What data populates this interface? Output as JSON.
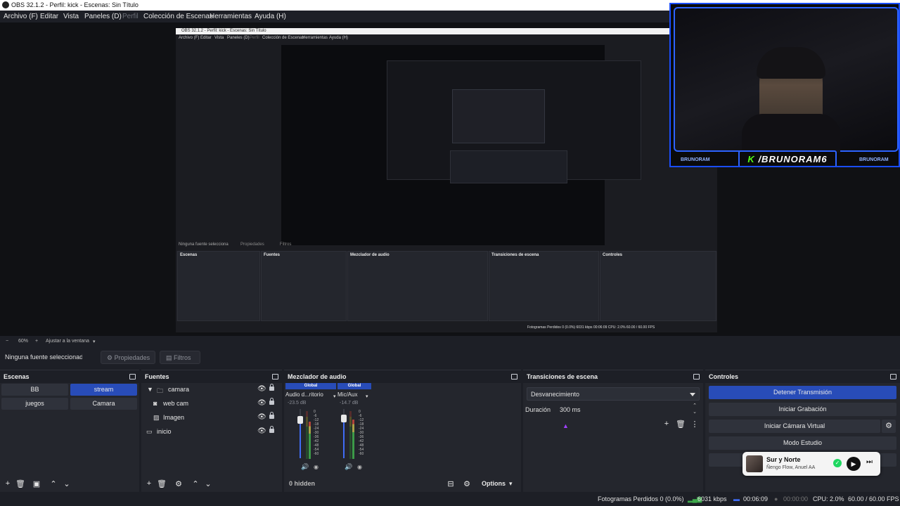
{
  "window": {
    "title": "OBS 32.1.2 - Perfil: kick - Escenas: Sin Título"
  },
  "menu": {
    "items": [
      "Archivo (F)",
      "Editar",
      "Vista",
      "Paneles (D)",
      "Perfil",
      "Colección de Escenas",
      "Herramientas",
      "Ayuda (H)"
    ]
  },
  "nested_preview": {
    "title": "OBS 32.1.2 - Perfil: kick - Escenas: Sin Título",
    "menu": [
      "Archivo (F)",
      "Editar",
      "Vista",
      "Paneles (D)",
      "Perfil",
      "Colección de Escenas",
      "Herramientas",
      "Ayuda (H)"
    ],
    "zoom_label": "60%",
    "fit_label": "Ajustar a la ventana",
    "selection_label": "Ninguna fuente selecciona",
    "props_label": "Propiedades",
    "filters_label": "Filtros",
    "docks": [
      "Escenas",
      "Fuentes",
      "Mezclador de audio",
      "Transiciones de escena",
      "Controles"
    ],
    "status": "Fotogramas Perdidos 0 (0.0%)   6031 kbps   00:06:09   CPU: 2.0%   60.00 / 60.00 FPS"
  },
  "camera_overlay": {
    "handle_k": "K",
    "handle": "/BRUNORAM6",
    "left_tag": "BRUNORAM",
    "right_tag": "BRUNORAM"
  },
  "zoom": {
    "minus": "−",
    "value": "60%",
    "plus": "+",
    "fit": "Ajustar a la ventana"
  },
  "source_toolbar": {
    "selection": "Ninguna fuente seleccionada",
    "properties": "Propiedades",
    "filters": "Filtros"
  },
  "scenes": {
    "title": "Escenas",
    "items": [
      {
        "label": "BB",
        "active": false
      },
      {
        "label": "stream",
        "active": true
      },
      {
        "label": "juegos",
        "active": false
      },
      {
        "label": "Camara",
        "active": false
      }
    ]
  },
  "sources": {
    "title": "Fuentes",
    "items": [
      {
        "label": "camara",
        "icon": "folder-icon"
      },
      {
        "label": "web cam",
        "icon": "camera-icon"
      },
      {
        "label": "Imagen",
        "icon": "image-icon"
      },
      {
        "label": "inicio",
        "icon": "display-icon"
      }
    ]
  },
  "mixer": {
    "title": "Mezclador de audio",
    "channels": [
      {
        "global": "Global",
        "name": "Audio d...ritorio",
        "db": "-23.5 dB",
        "level": 0.78
      },
      {
        "global": "Global",
        "name": "Mic/Aux",
        "db": "-14.7 dB",
        "level": 0.82
      }
    ],
    "scale": [
      "0",
      "-6",
      "-12",
      "-18",
      "-24",
      "-30",
      "-36",
      "-42",
      "-48",
      "-54",
      "-60"
    ],
    "hidden": "0 hidden",
    "options": "Options"
  },
  "transitions": {
    "title": "Transiciones de escena",
    "selected": "Desvanecimiento",
    "duration_label": "Duración",
    "duration_value": "300 ms"
  },
  "controls": {
    "title": "Controles",
    "buttons": [
      "Detener Transmisión",
      "Iniciar Grabación",
      "Iniciar Cámara Virtual",
      "Modo Estudio"
    ]
  },
  "media": {
    "track": "Sur y Norte",
    "artist": "Ñengo Flow, Anuel AA"
  },
  "status": {
    "dropped": "Fotogramas Perdidos 0 (0.0%)",
    "bitrate": "6031 kbps",
    "stream_time": "00:06:09",
    "rec_time": "00:00:00",
    "cpu": "CPU: 2.0%",
    "fps": "60.00 / 60.00 FPS"
  },
  "colors": {
    "accent": "#284cb8",
    "kick_green": "#53fc18",
    "overlay_blue": "#2d63ff"
  }
}
